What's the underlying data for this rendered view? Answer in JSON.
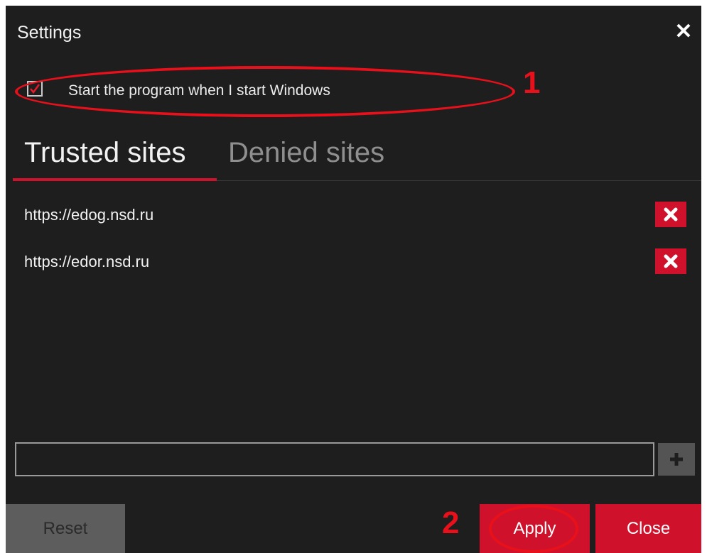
{
  "dialog": {
    "title": "Settings",
    "close_icon": "close-icon"
  },
  "startup": {
    "label": "Start the program when I start Windows",
    "checked": true
  },
  "tabs": [
    {
      "label": "Trusted sites",
      "active": true
    },
    {
      "label": "Denied sites",
      "active": false
    }
  ],
  "sites": [
    {
      "url": "https://edog.nsd.ru",
      "delete_icon": "delete-icon"
    },
    {
      "url": "https://edor.nsd.ru",
      "delete_icon": "delete-icon"
    }
  ],
  "new_site": {
    "value": "",
    "placeholder": "",
    "add_icon": "plus-icon"
  },
  "buttons": {
    "reset": "Reset",
    "apply": "Apply",
    "close": "Close"
  },
  "annotations": {
    "marker1": "1",
    "marker2": "2"
  },
  "colors": {
    "background": "#1e1e1e",
    "accent": "#d0112b",
    "annotation": "#e8101a"
  }
}
